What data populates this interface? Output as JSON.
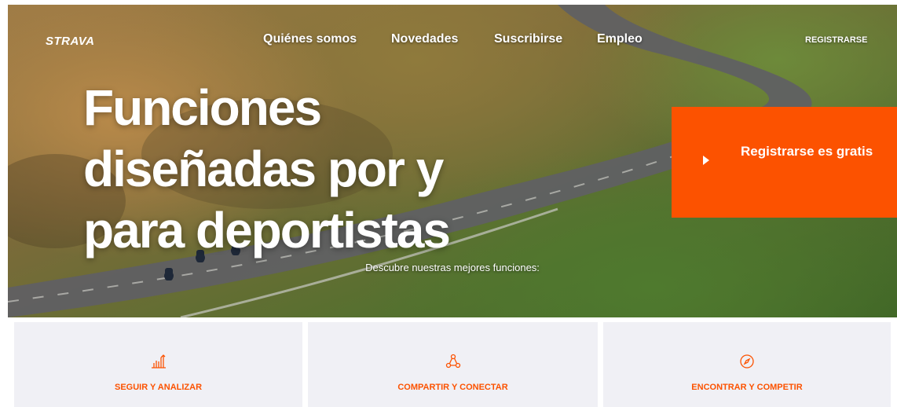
{
  "header": {
    "logo": "STRAVA",
    "nav": [
      {
        "label": "Quiénes somos"
      },
      {
        "label": "Novedades"
      },
      {
        "label": "Suscribirse"
      },
      {
        "label": "Empleo"
      }
    ],
    "register_label": "REGISTRARSE"
  },
  "hero": {
    "headline_lines": [
      "Funciones",
      "diseñadas por y",
      "para deportistas"
    ],
    "subline": "Descubre nuestras mejores funciones:",
    "cta": {
      "label": "Registrarse es gratis"
    }
  },
  "features": [
    {
      "label": "SEGUIR Y ANALIZAR",
      "icon": "bar-chart-icon"
    },
    {
      "label": "COMPARTIR Y CONECTAR",
      "icon": "share-connect-icon"
    },
    {
      "label": "ENCONTRAR Y COMPETIR",
      "icon": "compass-icon"
    }
  ],
  "colors": {
    "brand": "#fc5200",
    "card_bg": "#f0f0f5"
  }
}
